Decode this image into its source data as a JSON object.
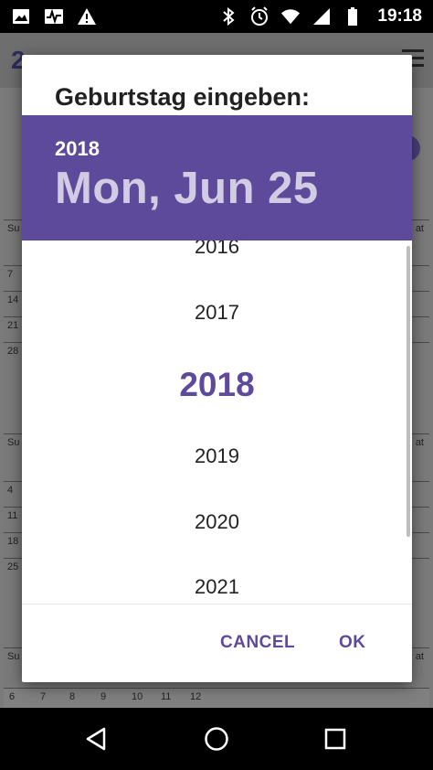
{
  "status_bar": {
    "time": "19:18",
    "left_icons": [
      "image-icon",
      "activity-icon",
      "warning-icon"
    ],
    "right_icons": [
      "bluetooth-icon",
      "alarm-icon",
      "wifi-icon",
      "signal-icon",
      "battery-icon"
    ]
  },
  "dialog": {
    "title": "Geburtstag eingeben:",
    "header": {
      "year": "2018",
      "date": "Mon, Jun 25",
      "background_color": "#5e4a9b"
    },
    "years": [
      "2016",
      "2017",
      "2018",
      "2019",
      "2020",
      "2021"
    ],
    "selected_year": "2018",
    "buttons": {
      "cancel": "CANCEL",
      "ok": "OK"
    },
    "accent_color": "#5e4a9b"
  },
  "background": {
    "rows": [
      [
        "Su",
        "at"
      ],
      [
        "7",
        ""
      ],
      [
        "14",
        ""
      ],
      [
        "21",
        ""
      ],
      [
        "28",
        ""
      ],
      [
        "Su",
        "at"
      ],
      [
        "4",
        ""
      ],
      [
        "11",
        ""
      ],
      [
        "18",
        ""
      ],
      [
        "25",
        ""
      ],
      [
        "Su",
        "at"
      ]
    ],
    "bottom_cells": [
      "6",
      "7",
      "8",
      "9",
      "10",
      "11",
      "12"
    ]
  },
  "nav_bar": {
    "icons": [
      "back-icon",
      "home-icon",
      "recents-icon"
    ]
  }
}
